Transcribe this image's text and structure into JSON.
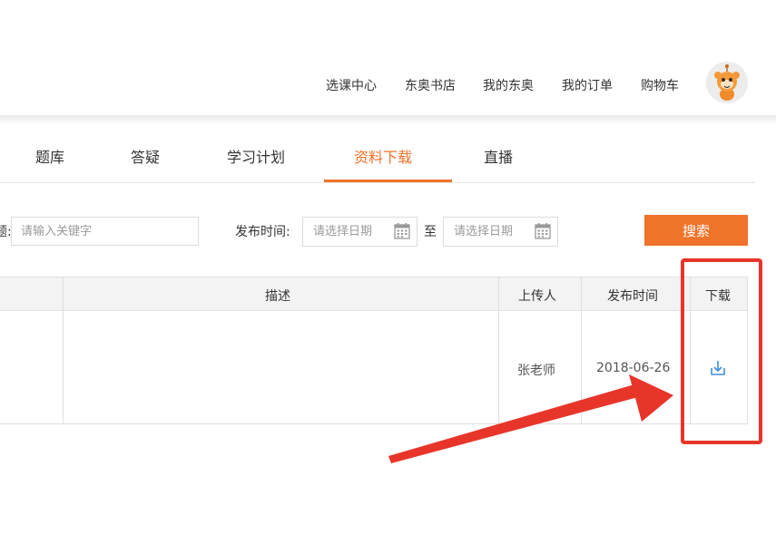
{
  "header": {
    "nav": [
      {
        "label": "选课中心"
      },
      {
        "label": "东奥书店"
      },
      {
        "label": "我的东奥"
      },
      {
        "label": "我的订单"
      },
      {
        "label": "购物车"
      }
    ]
  },
  "tabs": [
    {
      "label": "题库"
    },
    {
      "label": "答疑"
    },
    {
      "label": "学习计划"
    },
    {
      "label": "资料下载"
    },
    {
      "label": "直播"
    }
  ],
  "active_tab": "资料下载",
  "filters": {
    "keyword_label_fragment": "题:",
    "keyword_placeholder": "请输入关键字",
    "date_label": "发布时间:",
    "start_placeholder": "请选择日期",
    "range_separator": "至",
    "end_placeholder": "请选择日期",
    "search_label": "搜索"
  },
  "table": {
    "headers": [
      "描述",
      "上传人",
      "发布时间",
      "下载"
    ],
    "rows": [
      {
        "description": "",
        "uploader": "张老师",
        "date": "2018-06-26"
      }
    ]
  },
  "colors": {
    "accent": "#f0732a",
    "annotation": "#e8352a",
    "download_icon": "#3d8fe0"
  },
  "icons": [
    "calendar-icon",
    "download-icon",
    "avatar-mascot"
  ]
}
